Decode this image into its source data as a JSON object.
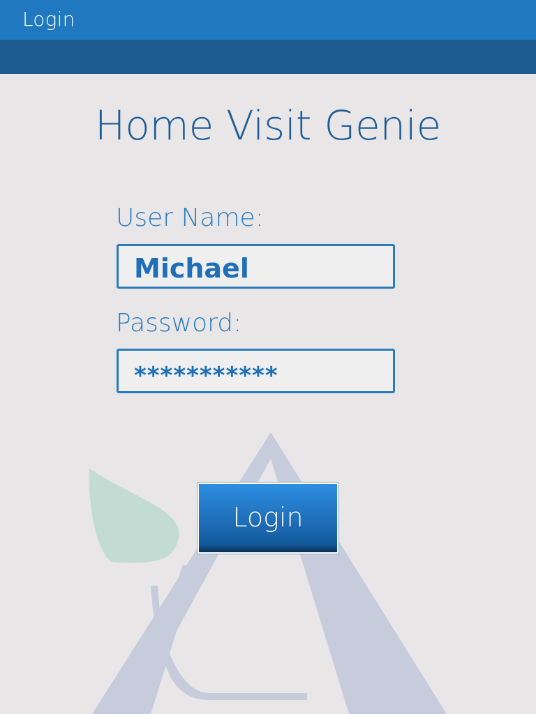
{
  "title_bar": {
    "title": "Login"
  },
  "app": {
    "name": "Home Visit Genie"
  },
  "form": {
    "username": {
      "label": "User Name:",
      "value": "Michael"
    },
    "password": {
      "label": "Password:",
      "value": "***********"
    },
    "submit_label": "Login"
  },
  "colors": {
    "title_bar": "#2078c0",
    "sub_bar": "#1c5a8f",
    "background": "#e8e6e7",
    "accent": "#2b7bbf",
    "heading": "#1f5c96"
  },
  "watermark": {
    "icons": [
      "triangle-logo-icon",
      "leaf-icon"
    ]
  }
}
